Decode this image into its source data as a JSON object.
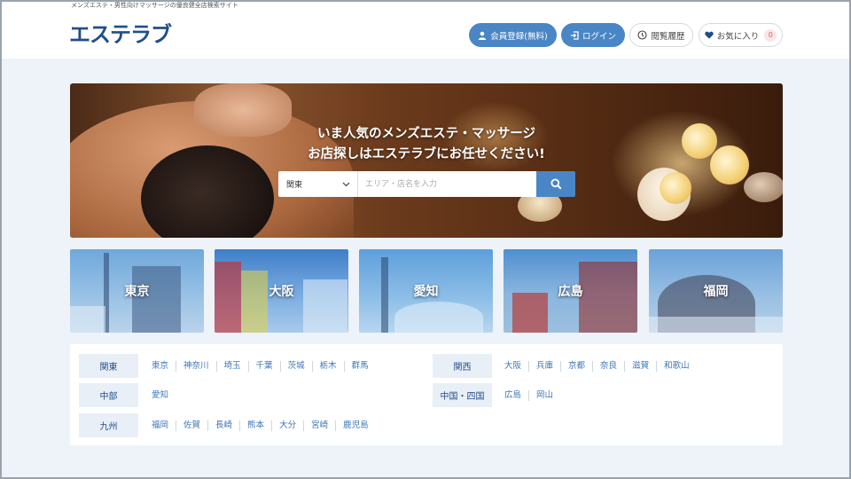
{
  "header": {
    "tagline": "メンズエステ・男性向けマッサージの優良健全店検索サイト",
    "logo": "エステラブ",
    "register_label": "会員登録(無料)",
    "login_label": "ログイン",
    "history_label": "閲覧履歴",
    "favorites_label": "お気に入り",
    "favorites_count": "0",
    "icons": [
      "user-icon",
      "login-icon",
      "clock-icon",
      "heart-icon"
    ]
  },
  "hero": {
    "title_line1": "いま人気のメンズエステ・マッサージ",
    "title_line2": "お店探しはエステラブにお任せください!",
    "region_selected": "関東",
    "search_placeholder": "エリア・店名を入力"
  },
  "cities": [
    {
      "name": "東京"
    },
    {
      "name": "大阪"
    },
    {
      "name": "愛知"
    },
    {
      "name": "広島"
    },
    {
      "name": "福岡"
    }
  ],
  "regions": [
    {
      "label": "関東",
      "prefectures": [
        "東京",
        "神奈川",
        "埼玉",
        "千葉",
        "茨城",
        "栃木",
        "群馬"
      ]
    },
    {
      "label": "中部",
      "prefectures": [
        "愛知"
      ]
    },
    {
      "label": "九州",
      "prefectures": [
        "福岡",
        "佐賀",
        "長崎",
        "熊本",
        "大分",
        "宮崎",
        "鹿児島"
      ]
    },
    {
      "label": "関西",
      "prefectures": [
        "大阪",
        "兵庫",
        "京都",
        "奈良",
        "滋賀",
        "和歌山"
      ]
    },
    {
      "label": "中国・四国",
      "prefectures": [
        "広島",
        "岡山"
      ]
    }
  ],
  "colors": {
    "brand": "#1f4e8c",
    "accent": "#4a86c5",
    "link": "#3e77b7",
    "page_bg": "#edf3f9"
  }
}
